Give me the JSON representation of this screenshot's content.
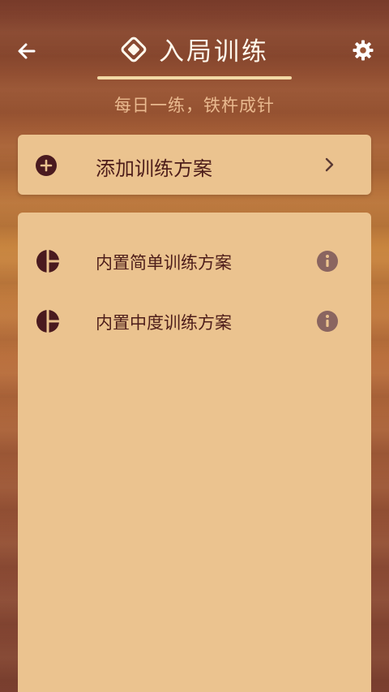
{
  "header": {
    "title": "入局训练",
    "subtitle": "每日一练，铁杵成针",
    "back_icon": "arrow-left-icon",
    "settings_icon": "gear-icon",
    "title_icon": "diamond-icon"
  },
  "add_plan": {
    "label": "添加训练方案",
    "icon": "plus-circle-icon",
    "chevron": "chevron-right-icon"
  },
  "plans": [
    {
      "label": "内置简单训练方案",
      "icon": "pie-icon",
      "info_icon": "info-icon"
    },
    {
      "label": "内置中度训练方案",
      "icon": "pie-icon",
      "info_icon": "info-icon"
    }
  ],
  "colors": {
    "card_bg": "#ebc38f",
    "text_dark": "#4d1d1a",
    "icon_dark": "#4a1a1f",
    "info_gray": "#8a6560",
    "title_light": "#fff8ec",
    "subtitle": "#e9b98f"
  }
}
